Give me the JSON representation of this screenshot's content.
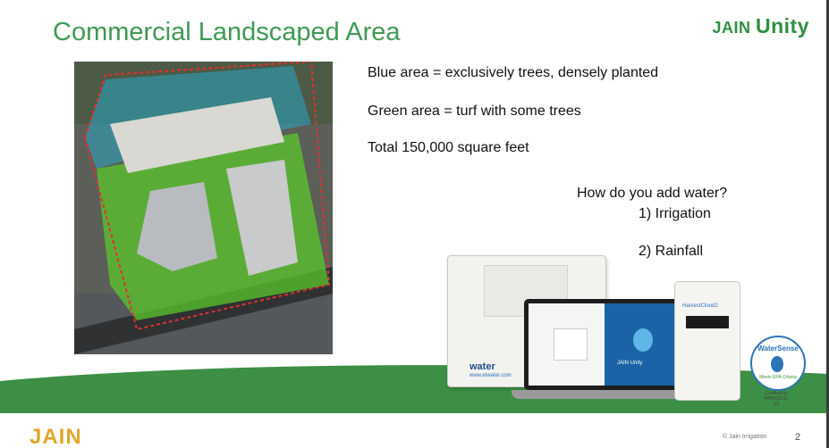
{
  "slide": {
    "title": "Commercial Landscaped Area",
    "logo": {
      "jain": "JAIN",
      "unity": "Unity"
    },
    "bullets": [
      "Blue area = exclusively trees, densely planted",
      "Green area = turf with some trees",
      "Total 150,000 square feet"
    ],
    "question": "How do you add water?",
    "answers": [
      "1) Irrigation",
      "2) Rainfall"
    ],
    "controller_brand": "water",
    "controller_url": "www.etwater.com",
    "laptop_brand": "JAIN Unity",
    "hydrawise_label": "HarvestCloud2",
    "watersense": "WaterSense",
    "watersense_sub": "Meets EPA Criteria",
    "certified": "Certified by IAPMO/ICC-ES",
    "footer_logo": "JAIN",
    "copyright": "© Jain Irrigation",
    "page_number": "2"
  },
  "colors": {
    "title": "#3f9a55",
    "green_band": "#3c8f45",
    "blue_overlay": "#29a8c8",
    "green_overlay": "#5cc82e"
  }
}
